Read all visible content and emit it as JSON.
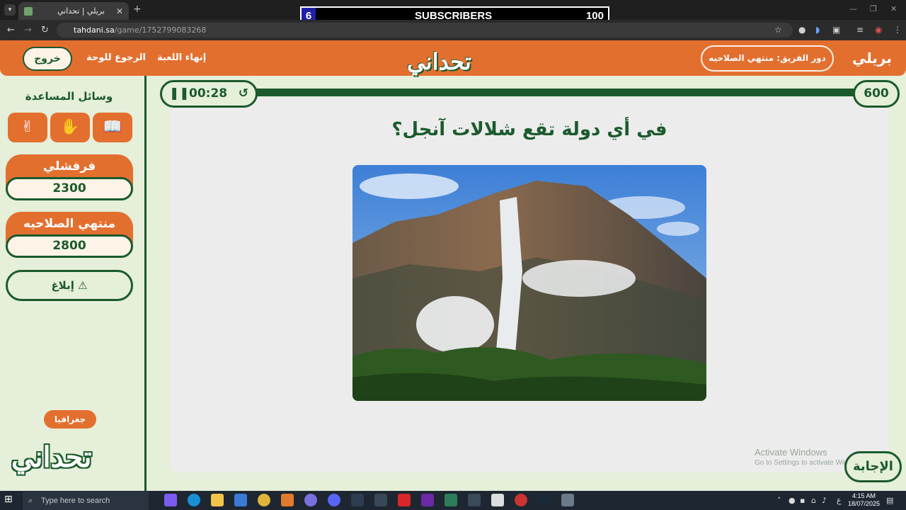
{
  "browser": {
    "tab_title": "بريلي | تحداني",
    "tab_close": "✕",
    "new_tab": "+",
    "address_host": "tahdani.sa",
    "address_path": "/game/1752799083268"
  },
  "stream_overlay": {
    "count": "6",
    "label": "SUBSCRIBERS",
    "goal": "100"
  },
  "header": {
    "exit_label": "خروج",
    "back_to_board_label": "الرجوع للوحة",
    "end_game_label": "إنهاء اللعبة",
    "logo_text": "تحداني",
    "turn_label": "دور الفريق:",
    "turn_team": "منتهي الصلاحيه",
    "game_name": "بريلي"
  },
  "sidebar": {
    "help_title": "وسائل المساعدة",
    "help_tools": [
      {
        "icon": "book-icon"
      },
      {
        "icon": "hand-icon"
      },
      {
        "icon": "peace-icon"
      }
    ],
    "teams": [
      {
        "name": "فرفشلي",
        "score": "2300"
      },
      {
        "name": "منتهي الصلاحيه",
        "score": "2800"
      }
    ],
    "report_label": "إبلاغ",
    "category_label": "جغرافيا",
    "logo_text": "تحداني"
  },
  "game": {
    "timer": "00:28",
    "points": "600",
    "question": "في أي دولة تقع شلالات آنجل؟",
    "answer_label": "الإجابة"
  },
  "watermark": {
    "line1": "Activate Windows",
    "line2": "Go to Settings to activate Windows."
  },
  "taskbar": {
    "search_placeholder": "Type here to search",
    "lang": "ع",
    "time": "4:15 AM",
    "date": "18/07/2025"
  },
  "colors": {
    "orange": "#e36f2f",
    "green": "#1b5a2d",
    "bg": "#e5efd9"
  }
}
